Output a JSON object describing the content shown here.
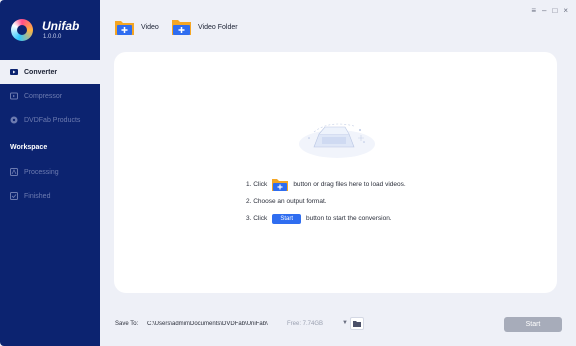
{
  "app": {
    "name": "Unifab",
    "version": "1.0.0.0"
  },
  "sidebar": {
    "items": [
      {
        "label": "Converter",
        "icon": "converter-icon",
        "active": true
      },
      {
        "label": "Compressor",
        "icon": "compressor-icon",
        "active": false
      },
      {
        "label": "DVDFab Products",
        "icon": "dvdfab-products-icon",
        "active": false
      }
    ],
    "workspace_title": "Workspace",
    "workspace_items": [
      {
        "label": "Processing",
        "icon": "processing-icon"
      },
      {
        "label": "Finished",
        "icon": "finished-icon"
      }
    ]
  },
  "toolbar": {
    "video_label": "Video",
    "video_folder_label": "Video Folder"
  },
  "window_controls": {
    "menu": "≡",
    "minimize": "–",
    "maximize": "□",
    "close": "×"
  },
  "instructions": {
    "step1_prefix": "1. Click",
    "step1_suffix": "button or drag files here to load videos.",
    "step2": "2. Choose an output format.",
    "step3_prefix": "3. Click",
    "step3_button": "Start",
    "step3_suffix": "button to start the conversion."
  },
  "bottom": {
    "save_to_label": "Save To:",
    "path": "C:\\Users\\admin\\Documents\\DVDFab\\UniFab\\",
    "free_space": "Free: 7.74GB",
    "start_label": "Start"
  },
  "colors": {
    "sidebar": "#0c2370",
    "accent": "#2f6df0",
    "folder": "#f5a623"
  }
}
